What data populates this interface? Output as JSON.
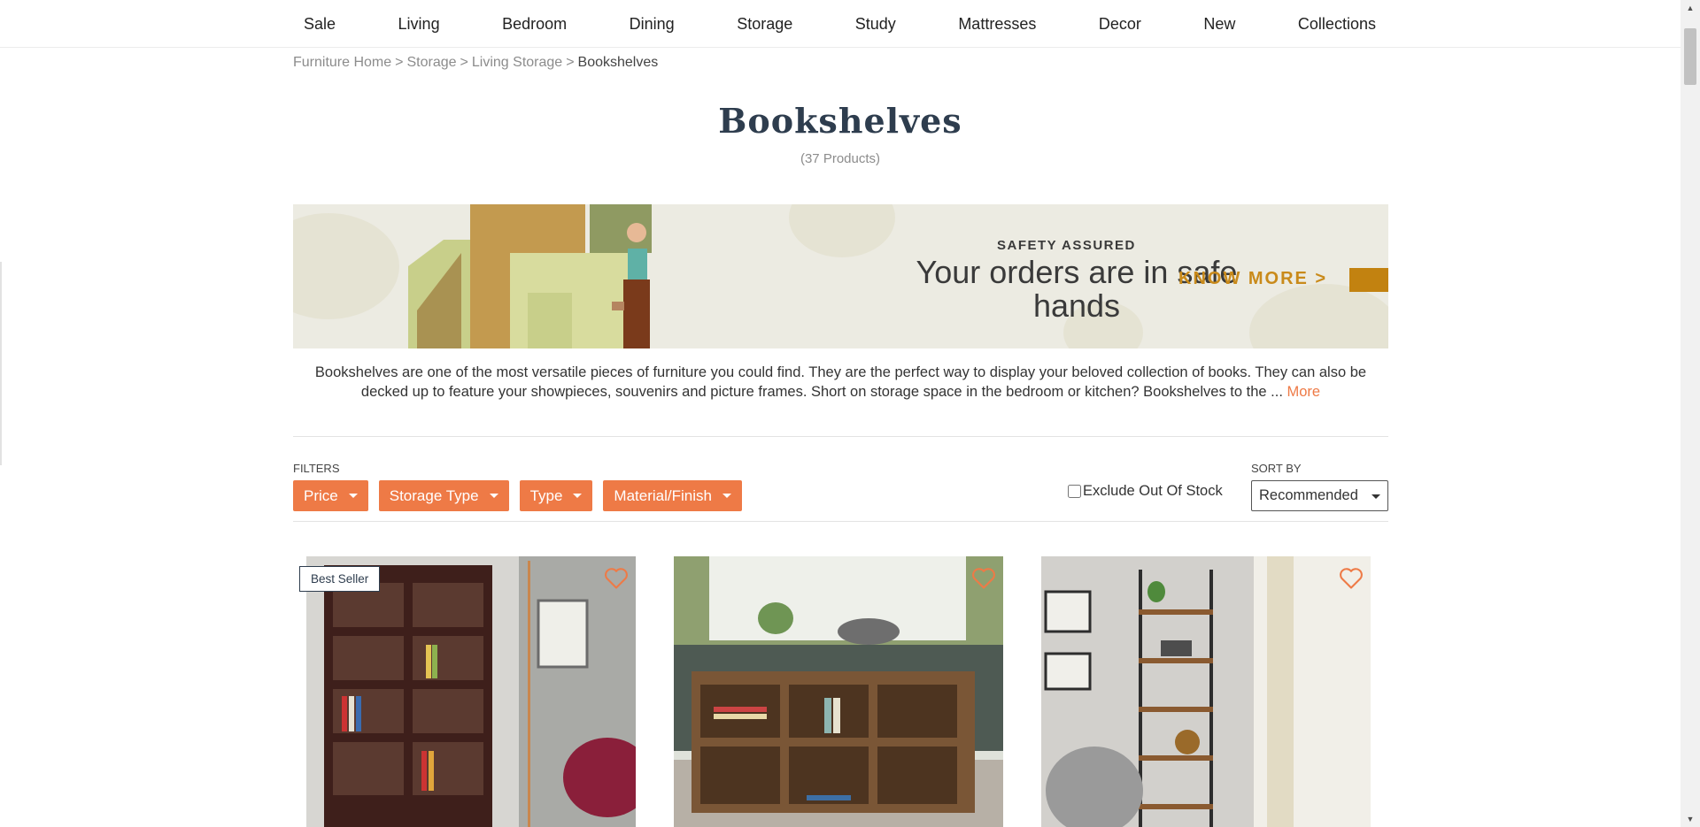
{
  "nav": {
    "items": [
      "Sale",
      "Living",
      "Bedroom",
      "Dining",
      "Storage",
      "Study",
      "Mattresses",
      "Decor",
      "New",
      "Collections"
    ]
  },
  "breadcrumb": {
    "items": [
      "Furniture Home",
      "Storage",
      "Living Storage"
    ],
    "separator": ">",
    "current": "Bookshelves"
  },
  "page": {
    "title": "Bookshelves",
    "count": "(37 Products)"
  },
  "banner": {
    "eyebrow": "SAFETY ASSURED",
    "headline": "Your orders are in safe hands",
    "cta": "KNOW MORE >"
  },
  "description": {
    "text": "Bookshelves are one of the most versatile pieces of furniture you could find. They are the perfect way to display your beloved collection of books. They can also be decked up to feature your showpieces, souvenirs and picture frames. Short on storage space in the bedroom or kitchen? Bookshelves to the ...",
    "more_label": "More"
  },
  "filters": {
    "label": "FILTERS",
    "buttons": [
      "Price",
      "Storage Type",
      "Type",
      "Material/Finish"
    ],
    "exclude_label": "Exclude Out Of Stock",
    "exclude_checked": false
  },
  "sort": {
    "label": "SORT BY",
    "selected": "Recommended"
  },
  "products": [
    {
      "badge": "Best Seller",
      "image": "dark-wood-bookshelf-photo"
    },
    {
      "badge": "",
      "image": "low-open-bookshelf-photo"
    },
    {
      "badge": "",
      "image": "ladder-metal-bookshelf-photo"
    }
  ],
  "colors": {
    "accent": "#ee7a46",
    "title": "#2e3d4e",
    "banner_bg": "#ecebe2",
    "banner_cta": "#c98a1a"
  }
}
